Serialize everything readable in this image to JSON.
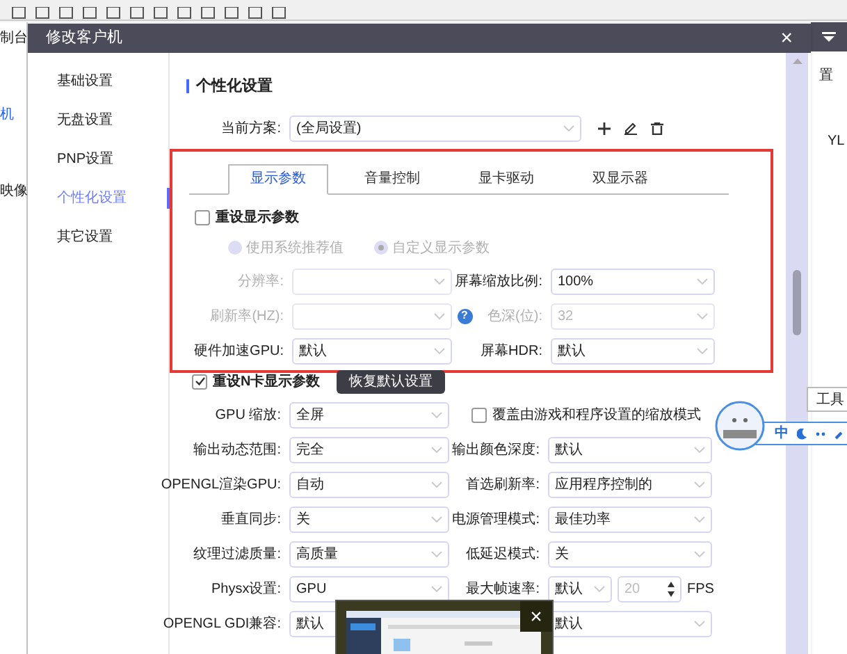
{
  "background": {
    "left_texts": [
      {
        "text": "制台",
        "kind": "plain"
      },
      {
        "text": "机",
        "kind": "link"
      },
      {
        "text": "映像",
        "kind": "plain"
      }
    ],
    "right_texts": [
      "置",
      "YL"
    ]
  },
  "dialog": {
    "title": "修改客户机",
    "close": "×"
  },
  "sidebar": {
    "items": [
      {
        "label": "基础设置",
        "selected": false
      },
      {
        "label": "无盘设置",
        "selected": false
      },
      {
        "label": "PNP设置",
        "selected": false
      },
      {
        "label": "个性化设置",
        "selected": true
      },
      {
        "label": "其它设置",
        "selected": false
      }
    ]
  },
  "section_title": "个性化设置",
  "scheme": {
    "label": "当前方案:",
    "value": "(全局设置)"
  },
  "tabs": [
    {
      "label": "显示参数",
      "selected": true
    },
    {
      "label": "音量控制",
      "selected": false
    },
    {
      "label": "显卡驱动",
      "selected": false
    },
    {
      "label": "双显示器",
      "selected": false
    }
  ],
  "reset_display": {
    "label": "重设显示参数",
    "checked": false
  },
  "radios": [
    {
      "label": "使用系统推荐值",
      "selected": false,
      "disabled": true
    },
    {
      "label": "自定义显示参数",
      "selected": true,
      "disabled": true
    }
  ],
  "display_rows": [
    {
      "left": {
        "label": "分辨率:",
        "disabled": true
      },
      "right": {
        "label": "屏幕缩放比例:",
        "value": "100%",
        "disabled": false
      }
    },
    {
      "left": {
        "label": "刷新率(HZ):",
        "disabled": true
      },
      "help": "?",
      "right": {
        "label": "色深(位):",
        "value": "32",
        "disabled": true
      }
    },
    {
      "left": {
        "label": "硬件加速GPU:",
        "value": "默认",
        "disabled": false
      },
      "right": {
        "label": "屏幕HDR:",
        "value": "默认",
        "disabled": false
      }
    }
  ],
  "reset_nvidia": {
    "label": "重设N卡显示参数",
    "checked": true,
    "button": "恢复默认设置"
  },
  "nvidia_rows": [
    {
      "left": {
        "label": "GPU 缩放:",
        "value": "全屏"
      },
      "right": {
        "kind": "checkbox",
        "label": "覆盖由游戏和程序设置的缩放模式",
        "checked": false
      }
    },
    {
      "left": {
        "label": "输出动态范围:",
        "value": "完全"
      },
      "right": {
        "kind": "select",
        "label": "输出颜色深度:",
        "value": "默认"
      }
    },
    {
      "left": {
        "label": "OPENGL渲染GPU:",
        "value": "自动"
      },
      "right": {
        "kind": "select",
        "label": "首选刷新率:",
        "value": "应用程序控制的"
      }
    },
    {
      "left": {
        "label": "垂直同步:",
        "value": "关"
      },
      "right": {
        "kind": "select",
        "label": "电源管理模式:",
        "value": "最佳功率"
      }
    },
    {
      "left": {
        "label": "纹理过滤质量:",
        "value": "高质量"
      },
      "right": {
        "kind": "select",
        "label": "低延迟模式:",
        "value": "关"
      }
    },
    {
      "left": {
        "label": "Physx设置:",
        "value": "GPU"
      },
      "right": {
        "kind": "fps",
        "label": "最大帧速率:",
        "value": "默认",
        "number": "20",
        "unit": "FPS"
      }
    },
    {
      "left": {
        "label": "OPENGL GDI兼容:",
        "value": "默认"
      },
      "right": {
        "kind": "select",
        "value": "默认"
      }
    }
  ],
  "thumbnail": {
    "close": "×"
  },
  "ime_bar": {
    "mode": "中"
  },
  "tooltip": "工具"
}
